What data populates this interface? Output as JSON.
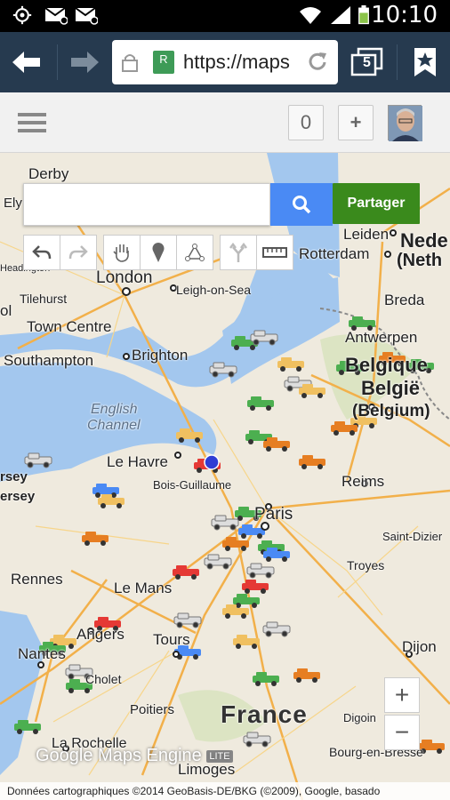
{
  "status_bar": {
    "time": "10:10"
  },
  "browser": {
    "url": "https://maps",
    "tab_count": "5",
    "site_badge": "R"
  },
  "app_header": {
    "counter": "0",
    "add_label": "+"
  },
  "map": {
    "search": {
      "placeholder": "",
      "value": ""
    },
    "share_label": "Partager",
    "labels": [
      "Derby",
      "Ely",
      "Leiden",
      "Nede",
      "(Neth",
      "Rotterdam",
      "Breda",
      "Antwerpen",
      "Belgique",
      "België",
      "(Belgium)",
      "London",
      "Leigh-on-Sea",
      "Tilehurst",
      "Town Centre",
      "Southampton",
      "Brighton",
      "English",
      "Channel",
      "Le Havre",
      "Bois-Guillaume",
      "Reims",
      "Paris",
      "Saint-Dizier",
      "Troyes",
      "Rennes",
      "Le Mans",
      "Angers",
      "Tours",
      "Nantes",
      "Cholet",
      "Poitiers",
      "France",
      "Dijon",
      "Digoin",
      "La Rochelle",
      "Limoges",
      "Bourg-en-Bresse",
      "Headington",
      "rsey",
      "ersey",
      "ol"
    ],
    "watermark": "Google Maps Engine",
    "watermark_badge": "LITE",
    "zoom_in": "+",
    "zoom_out": "−",
    "copyright": "Données cartographiques ©2014 GeoBasis-DE/BKG (©2009), Google, basado"
  },
  "colors": {
    "toolbar": "#263a4f",
    "search_blue": "#4a8af4",
    "share_green": "#3a8a1c",
    "sea": "#a3c7ee",
    "land": "#efeade"
  }
}
